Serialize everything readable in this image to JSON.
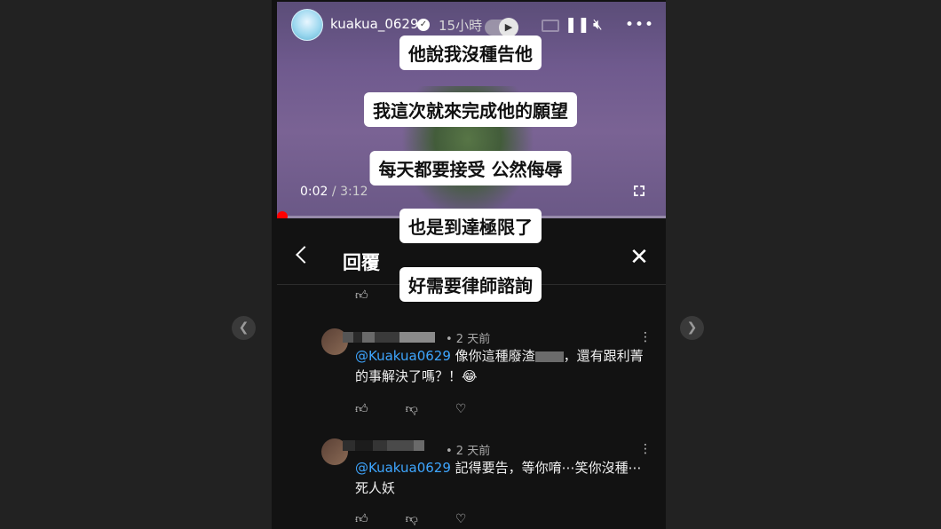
{
  "story": {
    "username": "kuakua_0629",
    "time_ago": "15小時",
    "current_time": "0:02",
    "duration": "3:12",
    "progress_fraction": 0.01,
    "accent": "#ff0000"
  },
  "captions": [
    "他說我沒種告他",
    "我這次就來完成他的願望",
    "每天都要接受 公然侮辱",
    "也是到達極限了",
    "好需要律師諮詢"
  ],
  "reply_panel": {
    "title": "回覆"
  },
  "comments": [
    {
      "time": "• 2 天前",
      "mention": "@Kuakua0629",
      "text": " 像你這種廢渣",
      "text_after_blur": "，還有跟利菁的事解決了嗎？！😂"
    },
    {
      "time": "• 2 天前",
      "mention": "@Kuakua0629",
      "text": " 記得要告，等你唷⋯笑你沒種⋯死人妖"
    }
  ],
  "icons": {
    "like": "thumb-up-icon",
    "dislike": "thumb-down-icon",
    "heart": "heart-icon",
    "more": "more-vertical-icon"
  }
}
